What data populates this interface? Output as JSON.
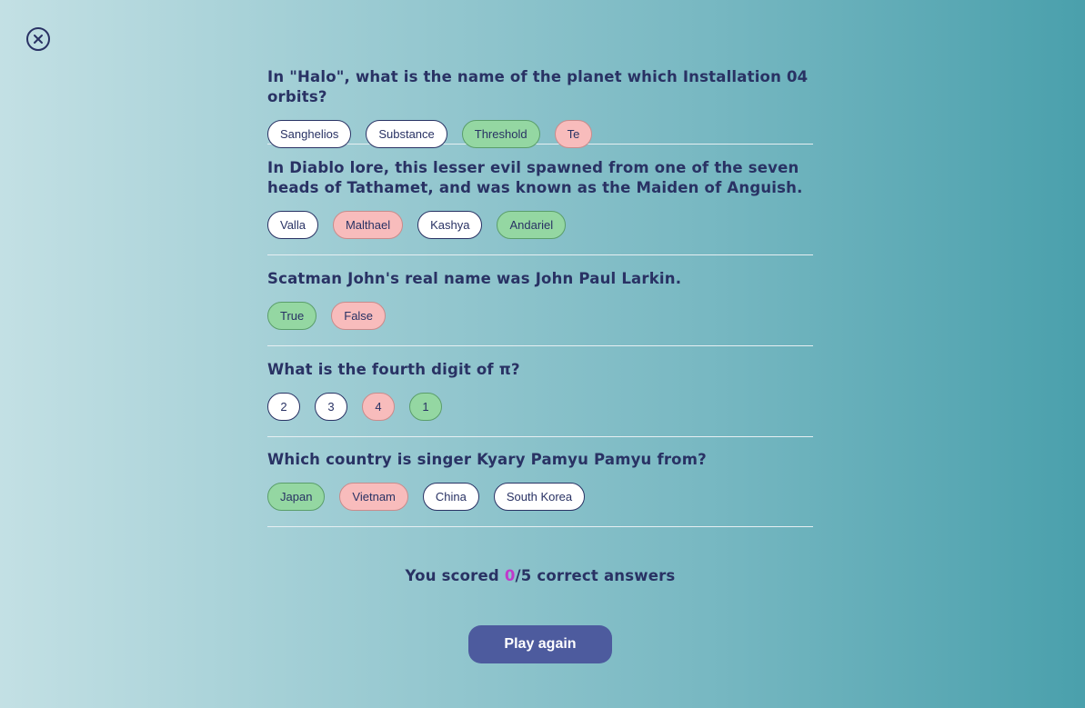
{
  "close_icon": "close-circle-icon",
  "questions": [
    {
      "text": "In \"Halo\", what is the name of the planet which Installation 04 orbits?",
      "answers": [
        {
          "label": "Sanghelios",
          "state": "neutral"
        },
        {
          "label": "Substance",
          "state": "neutral"
        },
        {
          "label": "Threshold",
          "state": "correct"
        },
        {
          "label": "Te",
          "state": "wrong"
        }
      ]
    },
    {
      "text": "In Diablo lore, this lesser evil spawned from one of the seven heads of Tathamet, and was known as the Maiden of Anguish.",
      "answers": [
        {
          "label": "Valla",
          "state": "neutral"
        },
        {
          "label": "Malthael",
          "state": "wrong"
        },
        {
          "label": "Kashya",
          "state": "neutral"
        },
        {
          "label": "Andariel",
          "state": "correct"
        }
      ]
    },
    {
      "text": "Scatman John's real name was John Paul Larkin.",
      "answers": [
        {
          "label": "True",
          "state": "correct"
        },
        {
          "label": "False",
          "state": "wrong"
        }
      ]
    },
    {
      "text": "What is the fourth digit of π?",
      "answers": [
        {
          "label": "2",
          "state": "neutral"
        },
        {
          "label": "3",
          "state": "neutral"
        },
        {
          "label": "4",
          "state": "wrong"
        },
        {
          "label": "1",
          "state": "correct"
        }
      ]
    },
    {
      "text": "Which country is singer Kyary Pamyu Pamyu from?",
      "answers": [
        {
          "label": "Japan",
          "state": "correct"
        },
        {
          "label": "Vietnam",
          "state": "wrong"
        },
        {
          "label": "China",
          "state": "neutral"
        },
        {
          "label": "South Korea",
          "state": "neutral"
        }
      ]
    }
  ],
  "score": {
    "prefix": "You scored ",
    "correct": "0",
    "suffix": "/5 correct answers"
  },
  "play_again_label": "Play again",
  "colors": {
    "text": "#293264",
    "correct": "#94d7a2",
    "wrong": "#f8bcbc",
    "score_number": "#c03acb",
    "button": "#4d5b9e"
  }
}
